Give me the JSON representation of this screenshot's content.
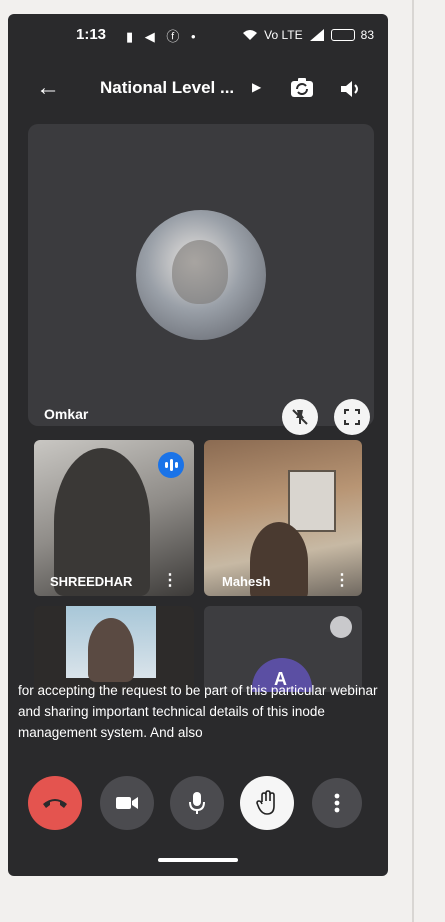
{
  "status_bar": {
    "time": "1:13",
    "left_icons": "▮ ◀ ⓕ •",
    "network": "Vo LTE",
    "battery": "83"
  },
  "header": {
    "title": "National Level ...",
    "chevron": "▶",
    "back_glyph": "←"
  },
  "main_participant": {
    "name": "Omkar"
  },
  "participants": [
    {
      "name": "SHREEDHAR",
      "speaking": true
    },
    {
      "name": "Mahesh",
      "speaking": false
    },
    {
      "name": "",
      "speaking": false
    },
    {
      "name": "",
      "avatar_letter": "A",
      "speaking": false
    }
  ],
  "captions": {
    "text": "for accepting the request to be part of this particular webinar and sharing important technical details of this inode management system. And also"
  },
  "controls": {
    "end_call_icon": "phone-hangup-icon",
    "camera_icon": "camera-icon",
    "mic_icon": "mic-icon",
    "raise_hand_icon": "hand-icon",
    "more_icon": "more-vert-icon"
  },
  "colors": {
    "end_call": "#e4544f",
    "speaking_indicator": "#1a73e8",
    "background": "#2a2a2c"
  }
}
